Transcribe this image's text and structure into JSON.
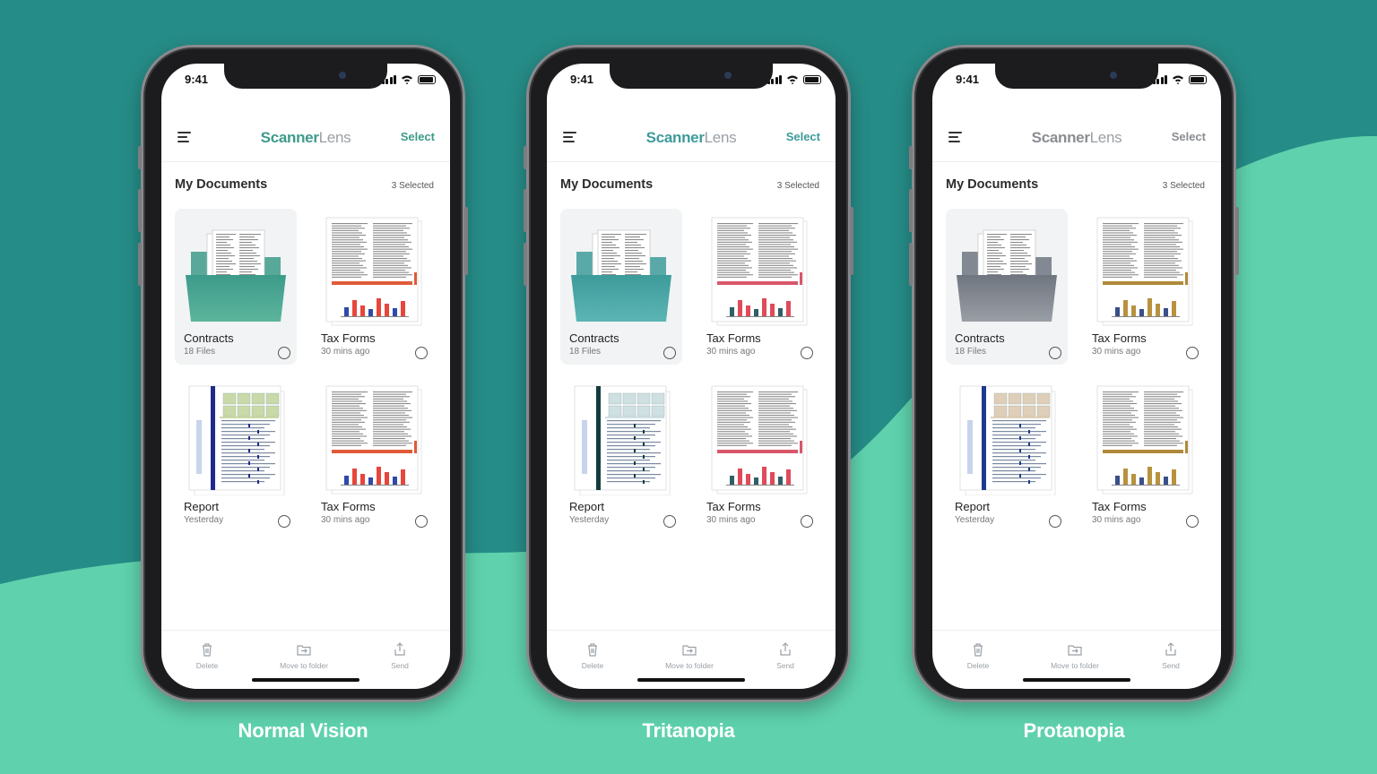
{
  "colors": {
    "background_dark": "#268c87",
    "background_light": "#5fd2ad"
  },
  "phones": [
    {
      "caption": "Normal Vision",
      "time": "9:41",
      "logo_part1": "Scanner",
      "logo_part2": "Lens",
      "select_label": "Select",
      "section_title": "My Documents",
      "selected_count": "3 Selected",
      "accent": "#3d9b8a",
      "folder_top": "#3d9b8a",
      "folder_bottom": "#5cb59c",
      "bar_colors": [
        "#2f4aa8",
        "#e8453c",
        "#e8453c",
        "#2f4aa8",
        "#e8453c",
        "#e8453c",
        "#2f4aa8",
        "#e8453c"
      ],
      "band_color": "#e05a3a",
      "stripe_color": "#1e2a8c",
      "highlight_color": "#c9d9a8",
      "cards": [
        {
          "title": "Contracts",
          "subtitle": "18 Files"
        },
        {
          "title": "Tax Forms",
          "subtitle": "30 mins ago"
        },
        {
          "title": "Report",
          "subtitle": "Yesterday"
        },
        {
          "title": "Tax Forms",
          "subtitle": "30 mins ago"
        }
      ],
      "tabs": [
        {
          "label": "Delete",
          "icon": "trash-icon"
        },
        {
          "label": "Move to folder",
          "icon": "folder-move-icon"
        },
        {
          "label": "Send",
          "icon": "share-icon"
        }
      ]
    },
    {
      "caption": "Tritanopia",
      "time": "9:41",
      "logo_part1": "Scanner",
      "logo_part2": "Lens",
      "select_label": "Select",
      "section_title": "My Documents",
      "selected_count": "3 Selected",
      "accent": "#3d9b9a",
      "folder_top": "#3d9b9a",
      "folder_bottom": "#5cb5b5",
      "bar_colors": [
        "#2f5f68",
        "#e04a5a",
        "#e04a5a",
        "#2f5f68",
        "#e04a5a",
        "#e04a5a",
        "#2f5f68",
        "#e04a5a"
      ],
      "band_color": "#d9566a",
      "stripe_color": "#123c3e",
      "highlight_color": "#cfe0e3",
      "cards": [
        {
          "title": "Contracts",
          "subtitle": "18 Files"
        },
        {
          "title": "Tax Forms",
          "subtitle": "30 mins ago"
        },
        {
          "title": "Report",
          "subtitle": "Yesterday"
        },
        {
          "title": "Tax Forms",
          "subtitle": "30 mins ago"
        }
      ],
      "tabs": [
        {
          "label": "Delete",
          "icon": "trash-icon"
        },
        {
          "label": "Move to folder",
          "icon": "folder-move-icon"
        },
        {
          "label": "Send",
          "icon": "share-icon"
        }
      ]
    },
    {
      "caption": "Protanopia",
      "time": "9:41",
      "logo_part1": "Scanner",
      "logo_part2": "Lens",
      "select_label": "Select",
      "section_title": "My Documents",
      "selected_count": "3 Selected",
      "accent": "#8a8d92",
      "folder_top": "#707680",
      "folder_bottom": "#9a9ea5",
      "bar_colors": [
        "#3a4f8a",
        "#b8923e",
        "#b8923e",
        "#3a4f8a",
        "#b8923e",
        "#b8923e",
        "#3a4f8a",
        "#b8923e"
      ],
      "band_color": "#b08a3a",
      "stripe_color": "#1e3a8c",
      "highlight_color": "#e0cfb8",
      "cards": [
        {
          "title": "Contracts",
          "subtitle": "18 Files"
        },
        {
          "title": "Tax Forms",
          "subtitle": "30 mins ago"
        },
        {
          "title": "Report",
          "subtitle": "Yesterday"
        },
        {
          "title": "Tax Forms",
          "subtitle": "30 mins ago"
        }
      ],
      "tabs": [
        {
          "label": "Delete",
          "icon": "trash-icon"
        },
        {
          "label": "Move to folder",
          "icon": "folder-move-icon"
        },
        {
          "label": "Send",
          "icon": "share-icon"
        }
      ]
    }
  ]
}
